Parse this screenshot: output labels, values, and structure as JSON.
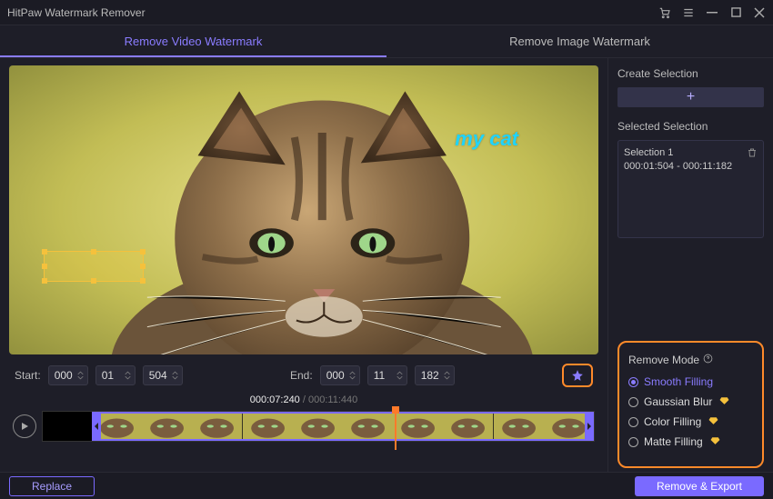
{
  "window_title": "HitPaw Watermark Remover",
  "tabs": {
    "video": "Remove Video Watermark",
    "image": "Remove Image Watermark"
  },
  "watermark_text": "my cat",
  "times": {
    "start_label": "Start:",
    "end_label": "End:",
    "start": [
      "000",
      "01",
      "504"
    ],
    "end": [
      "000",
      "11",
      "182"
    ]
  },
  "timecode": {
    "current": "000:07:240",
    "duration": "000:11:440"
  },
  "side": {
    "create_selection_label": "Create Selection",
    "selected_selection_label": "Selected Selection",
    "selections": [
      {
        "name": "Selection 1",
        "range": "000:01:504 - 000:11:182"
      }
    ]
  },
  "mode": {
    "title": "Remove Mode",
    "options": {
      "smooth": "Smooth Filling",
      "gaussian": "Gaussian Blur",
      "color": "Color Filling",
      "matte": "Matte Filling"
    }
  },
  "footer": {
    "replace": "Replace",
    "export": "Remove & Export"
  }
}
